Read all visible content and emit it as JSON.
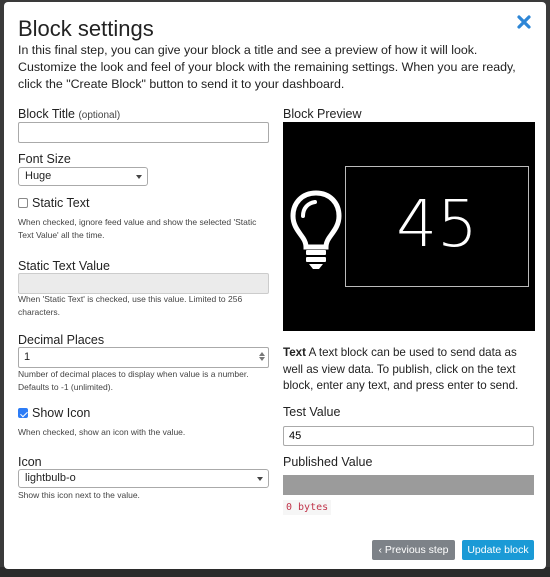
{
  "modal": {
    "title": "Block settings",
    "intro": "In this final step, you can give your block a title and see a preview of how it will look. Customize the look and feel of your block with the remaining settings. When you are ready, click the \"Create Block\" button to send it to your dashboard."
  },
  "form": {
    "block_title": {
      "label": "Block Title",
      "optional": "(optional)",
      "value": ""
    },
    "font_size": {
      "label": "Font Size",
      "selected": "Huge"
    },
    "static_text": {
      "label": "Static Text",
      "checked": false,
      "help": "When checked, ignore feed value and show the selected 'Static Text Value' all the time."
    },
    "static_text_value": {
      "label": "Static Text Value",
      "value": "",
      "help": "When 'Static Text' is checked, use this value. Limited to 256 characters."
    },
    "decimal_places": {
      "label": "Decimal Places",
      "value": "1",
      "help": "Number of decimal places to display when value is a number. Defaults to -1 (unlimited)."
    },
    "show_icon": {
      "label": "Show Icon",
      "checked": true,
      "help": "When checked, show an icon with the value."
    },
    "icon": {
      "label": "Icon",
      "selected": "lightbulb-o",
      "help": "Show this icon next to the value."
    }
  },
  "preview": {
    "label": "Block Preview",
    "value": "45",
    "icon": "lightbulb-icon",
    "description_strong": "Text",
    "description": " A text block can be used to send data as well as view data. To publish, click on the text block, enter any text, and press enter to send."
  },
  "test": {
    "label": "Test Value",
    "value": "45"
  },
  "published": {
    "label": "Published Value",
    "bytes": "0 bytes"
  },
  "buttons": {
    "previous": "Previous step",
    "previous_icon": "chevron-left-icon",
    "update": "Update block"
  },
  "colors": {
    "accent": "#1a9ad6",
    "secondary": "#7d8288",
    "checkbox": "#2d7cf6",
    "code": "#c0344a"
  }
}
